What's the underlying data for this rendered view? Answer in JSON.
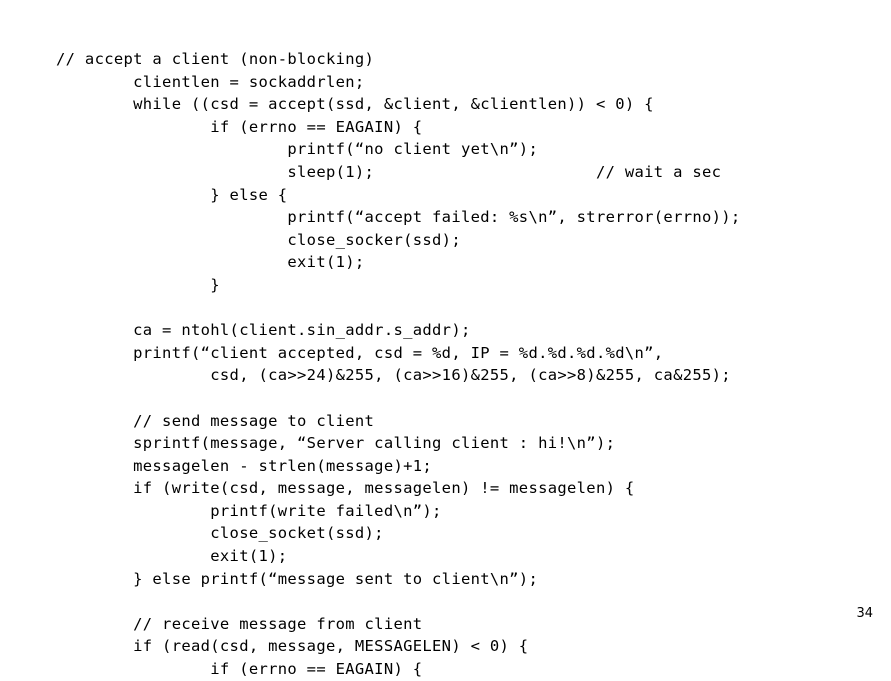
{
  "slide": {
    "page_number": "34",
    "background_color": "#ffffff",
    "text_color": "#000000",
    "code_lines": [
      "// accept a client (non-blocking)",
      "        clientlen = sockaddrlen;",
      "        while ((csd = accept(ssd, &client, &clientlen)) < 0) {",
      "                if (errno == EAGAIN) {",
      "                        printf(“no client yet\\n”);",
      "                        sleep(1);                       // wait a sec",
      "                } else {",
      "                        printf(“accept failed: %s\\n”, strerror(errno));",
      "                        close_socker(ssd);",
      "                        exit(1);",
      "                }",
      "",
      "        ca = ntohl(client.sin_addr.s_addr);",
      "        printf(“client accepted, csd = %d, IP = %d.%d.%d.%d\\n”,",
      "                csd, (ca>>24)&255, (ca>>16)&255, (ca>>8)&255, ca&255);",
      "",
      "        // send message to client",
      "        sprintf(message, “Server calling client : hi!\\n”);",
      "        messagelen - strlen(message)+1;",
      "        if (write(csd, message, messagelen) != messagelen) {",
      "                printf(write failed\\n”);",
      "                close_socket(ssd);",
      "                exit(1);",
      "        } else printf(“message sent to client\\n”);",
      "",
      "        // receive message from client",
      "        if (read(csd, message, MESSAGELEN) < 0) {",
      "                if (errno == EAGAIN) {"
    ]
  }
}
